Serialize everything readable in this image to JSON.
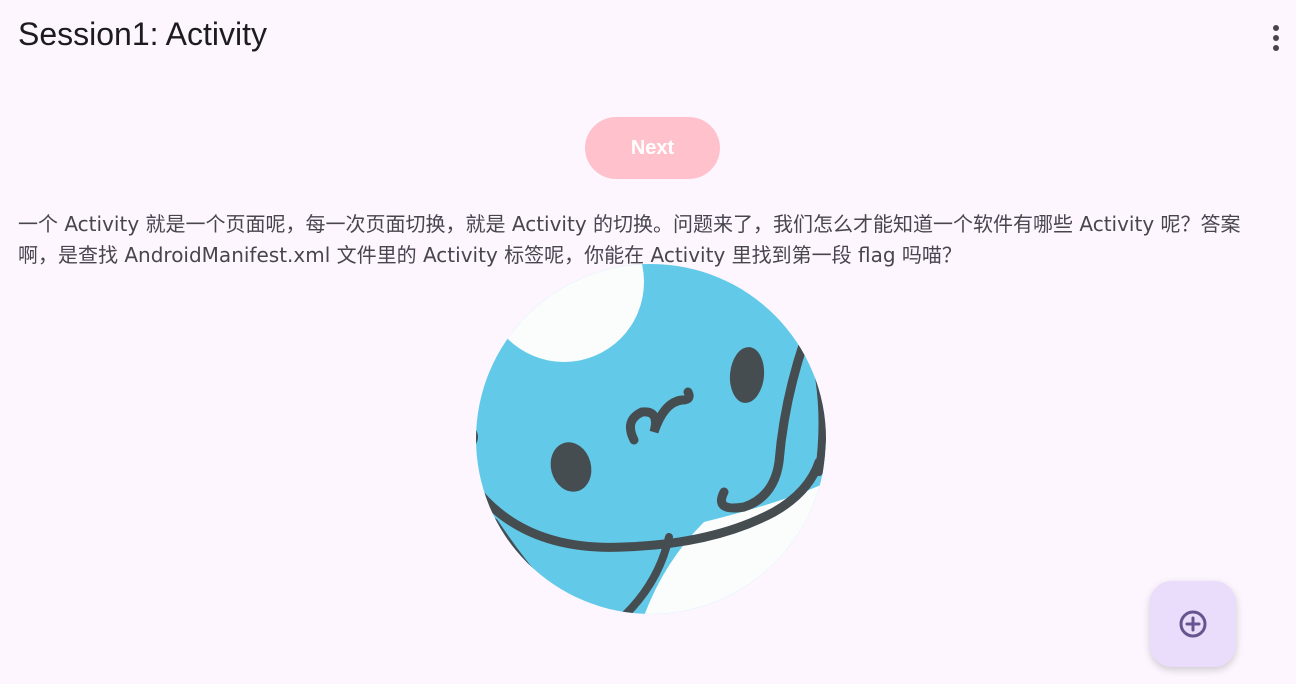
{
  "app_bar": {
    "title": "Session1: Activity",
    "menu_icon": "more-vert-icon"
  },
  "main": {
    "next_label": "Next",
    "description": "一个 Activity 就是一个页面呢，每一次页面切换，就是 Activity 的切换。问题来了，我们怎么才能知道一个软件有哪些 Activity 呢？答案啊，是查找 AndroidManifest.xml 文件里的 Activity 标签呢，你能在 Activity 里找到第一段 flag 吗喵？",
    "image": "mascot-image"
  },
  "fab": {
    "icon": "add-circle-icon"
  },
  "colors": {
    "background": "#fdf6fe",
    "next_button": "#ffc2cd",
    "fab": "#eadcfb",
    "fab_icon": "#65558f",
    "mascot_blue": "#63c9e8"
  }
}
